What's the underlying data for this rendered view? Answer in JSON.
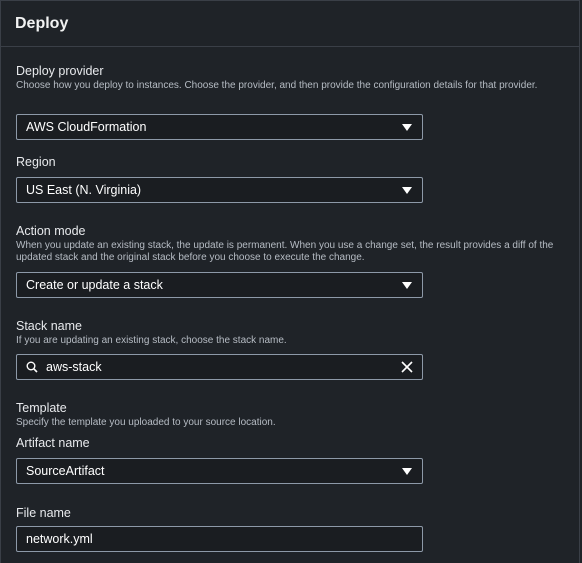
{
  "header": {
    "title": "Deploy"
  },
  "deploy_provider": {
    "label": "Deploy provider",
    "description": "Choose how you deploy to instances. Choose the provider, and then provide the configuration details for that provider.",
    "value": "AWS CloudFormation"
  },
  "region": {
    "label": "Region",
    "value": "US East (N. Virginia)"
  },
  "action_mode": {
    "label": "Action mode",
    "description": "When you update an existing stack, the update is permanent. When you use a change set, the result provides a diff of the updated stack and the original stack before you choose to execute the change.",
    "value": "Create or update a stack"
  },
  "stack_name": {
    "label": "Stack name",
    "description": "If you are updating an existing stack, choose the stack name.",
    "value": "aws-stack"
  },
  "template": {
    "label": "Template",
    "description": "Specify the template you uploaded to your source location."
  },
  "artifact_name": {
    "label": "Artifact name",
    "value": "SourceArtifact"
  },
  "file_name": {
    "label": "File name",
    "value": "network.yml"
  }
}
